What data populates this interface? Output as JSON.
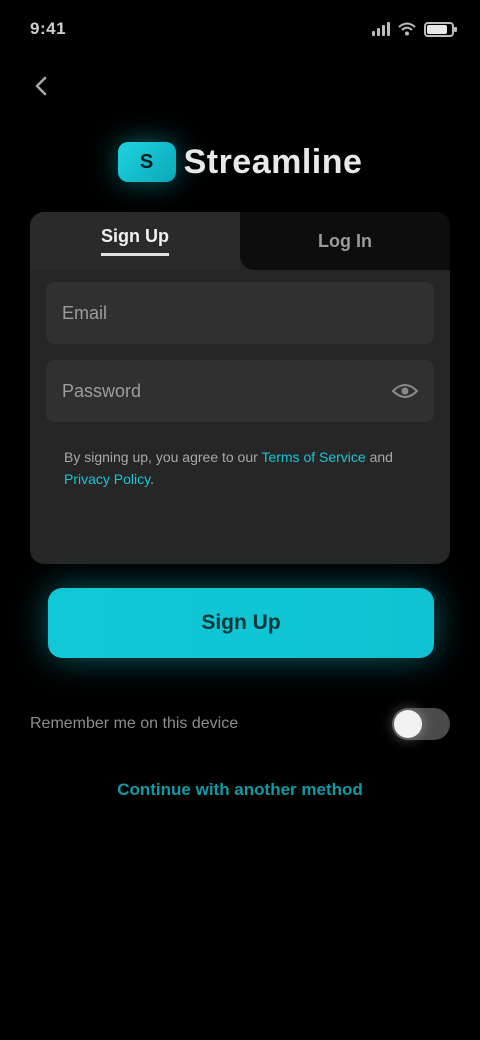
{
  "status_bar": {
    "time": "9:41",
    "battery_level": 0.85,
    "icons": [
      "signal-icon",
      "wifi-icon",
      "battery-icon"
    ]
  },
  "nav": {
    "back_icon": "arrow-left-icon"
  },
  "logo": {
    "mark": "S",
    "name": "Streamline"
  },
  "tabs": [
    {
      "label": "Sign Up",
      "active": true
    },
    {
      "label": "Log In",
      "active": false
    }
  ],
  "form": {
    "email_placeholder": "Email",
    "password_placeholder": "Password",
    "eye_icon": "eye-icon",
    "terms_prefix": "By signing up, you agree to our ",
    "terms_link": "Terms of Service",
    "terms_middle": " and ",
    "privacy_link": "Privacy Policy",
    "terms_suffix": "."
  },
  "primary_button": {
    "label": "Sign Up"
  },
  "remember": {
    "label": "Remember me on this device",
    "enabled": true
  },
  "footer_link": "Continue with another method",
  "colors": {
    "background": "#000000",
    "card": "#262626",
    "accent": "#12c8d6",
    "field": "#303030"
  }
}
